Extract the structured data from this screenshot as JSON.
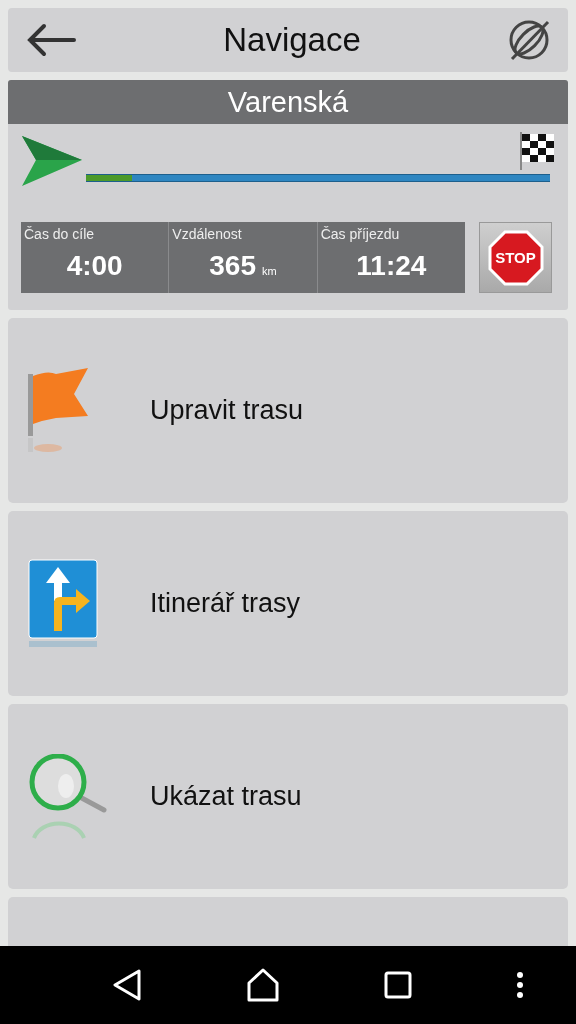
{
  "header": {
    "title": "Navigace"
  },
  "route": {
    "street": "Varenská",
    "level": 0.1,
    "stats": [
      {
        "label": "Čas do cíle",
        "value": "4:00"
      },
      {
        "label": "Vzdálenost",
        "value": "365",
        "unit": "km"
      },
      {
        "label": "Čas příjezdu",
        "value": "11:24"
      }
    ],
    "stop": "STOP"
  },
  "menu": [
    {
      "kind": "flag",
      "label": "Upravit trasu"
    },
    {
      "kind": "turns",
      "label": "Itinerář trasy"
    },
    {
      "kind": "magnifier",
      "label": "Ukázat trasu"
    }
  ]
}
